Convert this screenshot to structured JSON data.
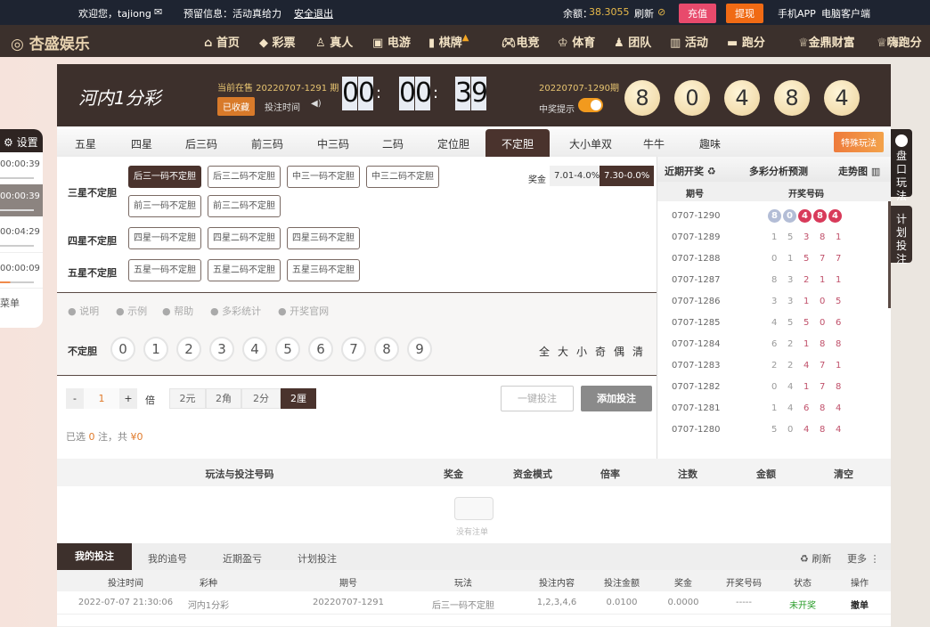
{
  "topbar": {
    "welcome": "欢迎您，tajiong",
    "notice": "预留信息：活动真给力",
    "logout": "安全退出",
    "balance_label": "余额：",
    "balance": "38.3055",
    "refresh": "刷新",
    "recharge": "充值",
    "withdraw": "提现",
    "app": "手机APP",
    "client": "电脑客户端"
  },
  "nav": {
    "logo": "杏盛娱乐",
    "items": [
      "首页",
      "彩票",
      "真人",
      "电游",
      "棋牌",
      "电竞",
      "体育",
      "团队",
      "活动",
      "跑分",
      "金鼎财富",
      "嗨跑分"
    ]
  },
  "header": {
    "game_logo": "河内1分彩",
    "current_label": "当前在售 20220707-1291 期",
    "favorited": "已收藏",
    "bet_time": "投注时间",
    "countdown": [
      "0",
      "0",
      "0",
      "0",
      "3",
      "9"
    ],
    "last_issue": "20220707-1290期",
    "win_alert": "中奖提示",
    "win_alert_on": true,
    "balls": [
      "8",
      "0",
      "4",
      "8",
      "4"
    ]
  },
  "tabs": [
    "五星",
    "四星",
    "后三码",
    "前三码",
    "中三码",
    "二码",
    "定位胆",
    "不定胆",
    "大小单双",
    "牛牛",
    "趣味"
  ],
  "special_play": "特殊玩法",
  "groups": [
    {
      "label": "三星不定胆",
      "options": [
        "后三一码不定胆",
        "后三二码不定胆",
        "中三一码不定胆",
        "中三二码不定胆",
        "前三一码不定胆",
        "前三二码不定胆"
      ]
    },
    {
      "label": "四星不定胆",
      "options": [
        "四星一码不定胆",
        "四星二码不定胆",
        "四星三码不定胆"
      ]
    },
    {
      "label": "五星不定胆",
      "options": [
        "五星一码不定胆",
        "五星二码不定胆",
        "五星三码不定胆"
      ]
    }
  ],
  "prize": {
    "label": "奖金",
    "options": [
      "7.01-4.0%",
      "7.30-0.0%"
    ]
  },
  "tools": [
    "说明",
    "示例",
    "帮助",
    "多彩统计",
    "开奖官网"
  ],
  "picker": {
    "label": "不定胆",
    "numbers": [
      "0",
      "1",
      "2",
      "3",
      "4",
      "5",
      "6",
      "7",
      "8",
      "9"
    ],
    "quick": [
      "全",
      "大",
      "小",
      "奇",
      "偶",
      "清"
    ]
  },
  "bet": {
    "minus": "-",
    "multiple": "1",
    "plus": "+",
    "times": "倍",
    "units": [
      "2元",
      "2角",
      "2分",
      "2厘"
    ],
    "one_click": "一键投注",
    "add": "添加投注",
    "summary_a": "已选",
    "count": "0",
    "summary_b": "注，共",
    "amount": "¥0"
  },
  "recent": {
    "tabs": [
      "近期开奖",
      "多彩分析预测",
      "走势图"
    ],
    "head": [
      "期号",
      "开奖号码"
    ],
    "rows": [
      [
        "0707-1290",
        "8 0 4 8 4"
      ],
      [
        "0707-1289",
        "1 5 3 8 1"
      ],
      [
        "0707-1288",
        "0 1 5 7 7"
      ],
      [
        "0707-1287",
        "8 3 2 1 1"
      ],
      [
        "0707-1286",
        "3 3 1 0 5"
      ],
      [
        "0707-1285",
        "4 5 5 0 6"
      ],
      [
        "0707-1284",
        "6 2 1 8 8"
      ],
      [
        "0707-1283",
        "2 2 4 7 1"
      ],
      [
        "0707-1282",
        "0 4 1 7 8"
      ],
      [
        "0707-1281",
        "1 4 6 8 4"
      ],
      [
        "0707-1280",
        "5 0 4 8 4"
      ]
    ]
  },
  "cart": {
    "head": [
      "玩法与投注号码",
      "奖金",
      "资金模式",
      "倍率",
      "注数",
      "金额",
      "清空"
    ],
    "empty": "没有注单"
  },
  "bottom": {
    "tabs": [
      "我的投注",
      "我的追号",
      "近期盈亏",
      "计划投注"
    ],
    "refresh": "刷新",
    "more": "更多",
    "head": [
      "投注时间",
      "彩种",
      "期号",
      "玩法",
      "投注内容",
      "投注金额",
      "奖金",
      "开奖号码",
      "状态",
      "操作"
    ],
    "rows": [
      [
        "2022-07-07 21:30:06",
        "河内1分彩",
        "20220707-1291",
        "后三一码不定胆",
        "1,2,3,4,6",
        "0.0100",
        "0.0000",
        "-----",
        "未开奖",
        "撤单"
      ]
    ]
  },
  "side_left": {
    "settings": "设置",
    "timers": [
      "00:00:39",
      "00:00:39",
      "00:04:29",
      "00:00:09"
    ],
    "menu": "菜单"
  },
  "side_right": [
    "盘口玩法",
    "计划投注"
  ]
}
